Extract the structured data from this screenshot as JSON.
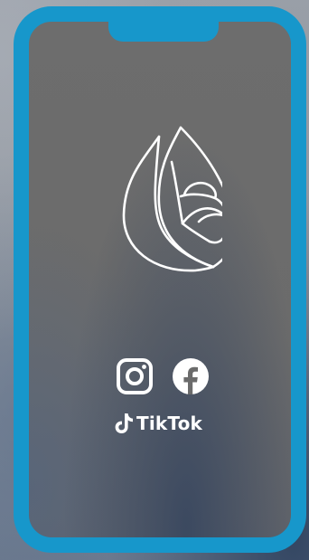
{
  "colors": {
    "frame": "#1797cb",
    "screen": "#6b6b6b",
    "icons": "#ffffff"
  },
  "phone": {
    "logo_icon": "water-drop-rose-logo",
    "social_links": [
      {
        "icon": "instagram-icon"
      },
      {
        "icon": "facebook-icon"
      }
    ],
    "tiktok": {
      "icon": "tiktok-icon",
      "label": "TikTok"
    }
  }
}
